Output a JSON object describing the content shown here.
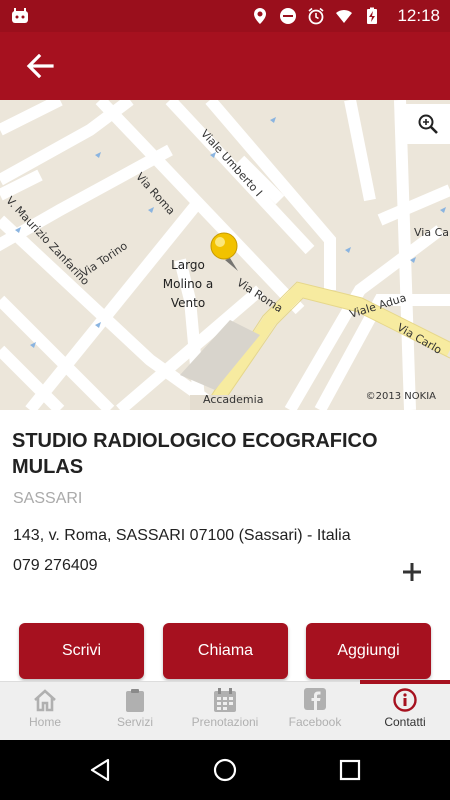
{
  "status_bar": {
    "time": "12:18",
    "icons": [
      "android-icon",
      "location-icon",
      "do-not-disturb-icon",
      "alarm-icon",
      "wifi-icon",
      "battery-charging-icon"
    ]
  },
  "app_bar": {
    "back_icon": "arrow-left-icon",
    "color": "#a6111f"
  },
  "map": {
    "streets": [
      "Viale Umberto I",
      "Via Roma",
      "V. Maurizio Zanfarino",
      "Via Torino",
      "Via Roma",
      "Viale Adua",
      "Via Carlo",
      "Via Carlo",
      "Accademia"
    ],
    "place": "Largo Molino a Vento",
    "copyright": "©2013 NOKIA",
    "zoom_icon": "zoom-in-icon"
  },
  "business": {
    "name": "STUDIO RADIOLOGICO ECOGRAFICO MULAS",
    "city": "SASSARI",
    "address": "143, v. Roma, SASSARI 07100 (Sassari) - Italia",
    "phone": "079 276409",
    "expand_icon": "plus-icon"
  },
  "actions": {
    "write": "Scrivi",
    "call": "Chiama",
    "add": "Aggiungi"
  },
  "tabs": [
    {
      "label": "Home",
      "icon": "home-icon",
      "active": false
    },
    {
      "label": "Servizi",
      "icon": "clipboard-icon",
      "active": false
    },
    {
      "label": "Prenotazioni",
      "icon": "calendar-icon",
      "active": false
    },
    {
      "label": "Facebook",
      "icon": "facebook-icon",
      "active": false
    },
    {
      "label": "Contatti",
      "icon": "info-icon",
      "active": true
    }
  ],
  "nav": [
    "back-triangle-icon",
    "home-circle-icon",
    "recents-square-icon"
  ],
  "colors": {
    "brand": "#a6111f",
    "status_bar": "#9a0f1c",
    "tab_inactive": "#b0b0b0"
  }
}
